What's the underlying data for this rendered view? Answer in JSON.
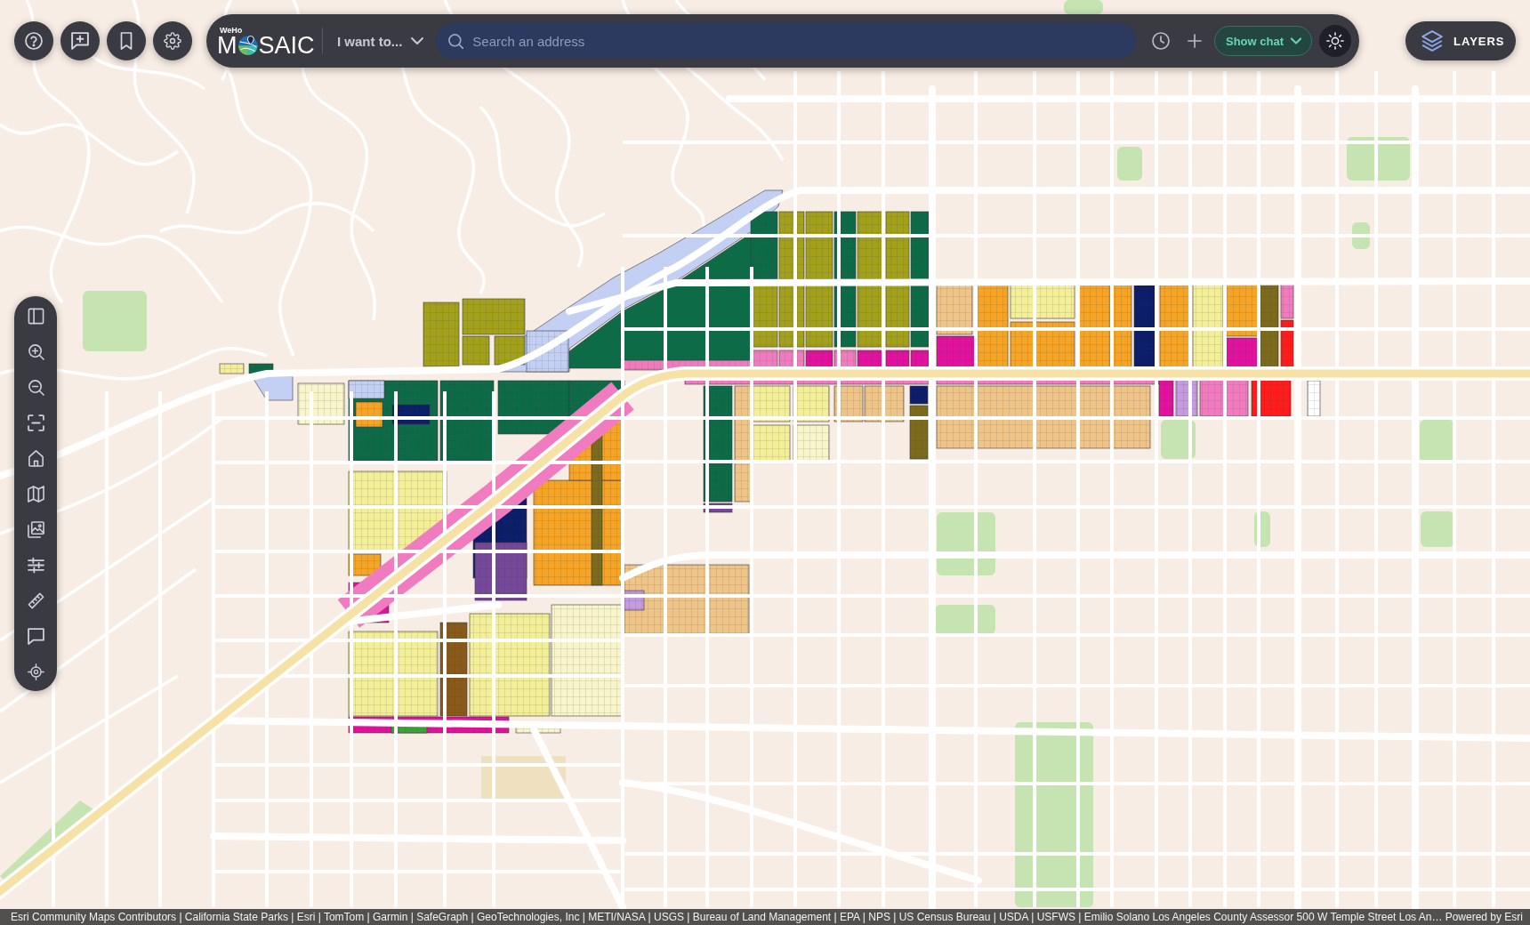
{
  "quick_buttons": [
    {
      "kind": "help"
    },
    {
      "kind": "feedback"
    },
    {
      "kind": "bookmark"
    },
    {
      "kind": "settings"
    }
  ],
  "top_bar": {
    "logo": {
      "tagline": "WeHo",
      "before_mark": "M",
      "after_mark": "SAIC"
    },
    "menu": {
      "label": "I want to..."
    },
    "search": {
      "placeholder": "Search an address"
    },
    "actions": [
      {
        "kind": "history"
      },
      {
        "kind": "add"
      },
      {
        "kind": "chat",
        "label": "Show chat"
      },
      {
        "kind": "theme"
      }
    ]
  },
  "layers_button": {
    "label": "LAYERS"
  },
  "map_tools": [
    {
      "kind": "panel"
    },
    {
      "kind": "zoom_in"
    },
    {
      "kind": "zoom_out"
    },
    {
      "kind": "extent"
    },
    {
      "kind": "home"
    },
    {
      "kind": "basemap"
    },
    {
      "kind": "imagery"
    },
    {
      "kind": "filter"
    },
    {
      "kind": "measure"
    },
    {
      "kind": "comment"
    },
    {
      "kind": "locate"
    }
  ],
  "attribution": {
    "sources": "Esri Community Maps Contributors | California State Parks | Esri | TomTom | Garmin | SafeGraph | GeoTechnologies, Inc | METI/NASA | USGS | Bureau of Land Management | EPA | NPS | US Census Bureau | USDA | USFWS | Emilio Solano Los Angeles County Assessor 500 W Temple Street Los An…",
    "powered_by": "Powered by Esri"
  }
}
